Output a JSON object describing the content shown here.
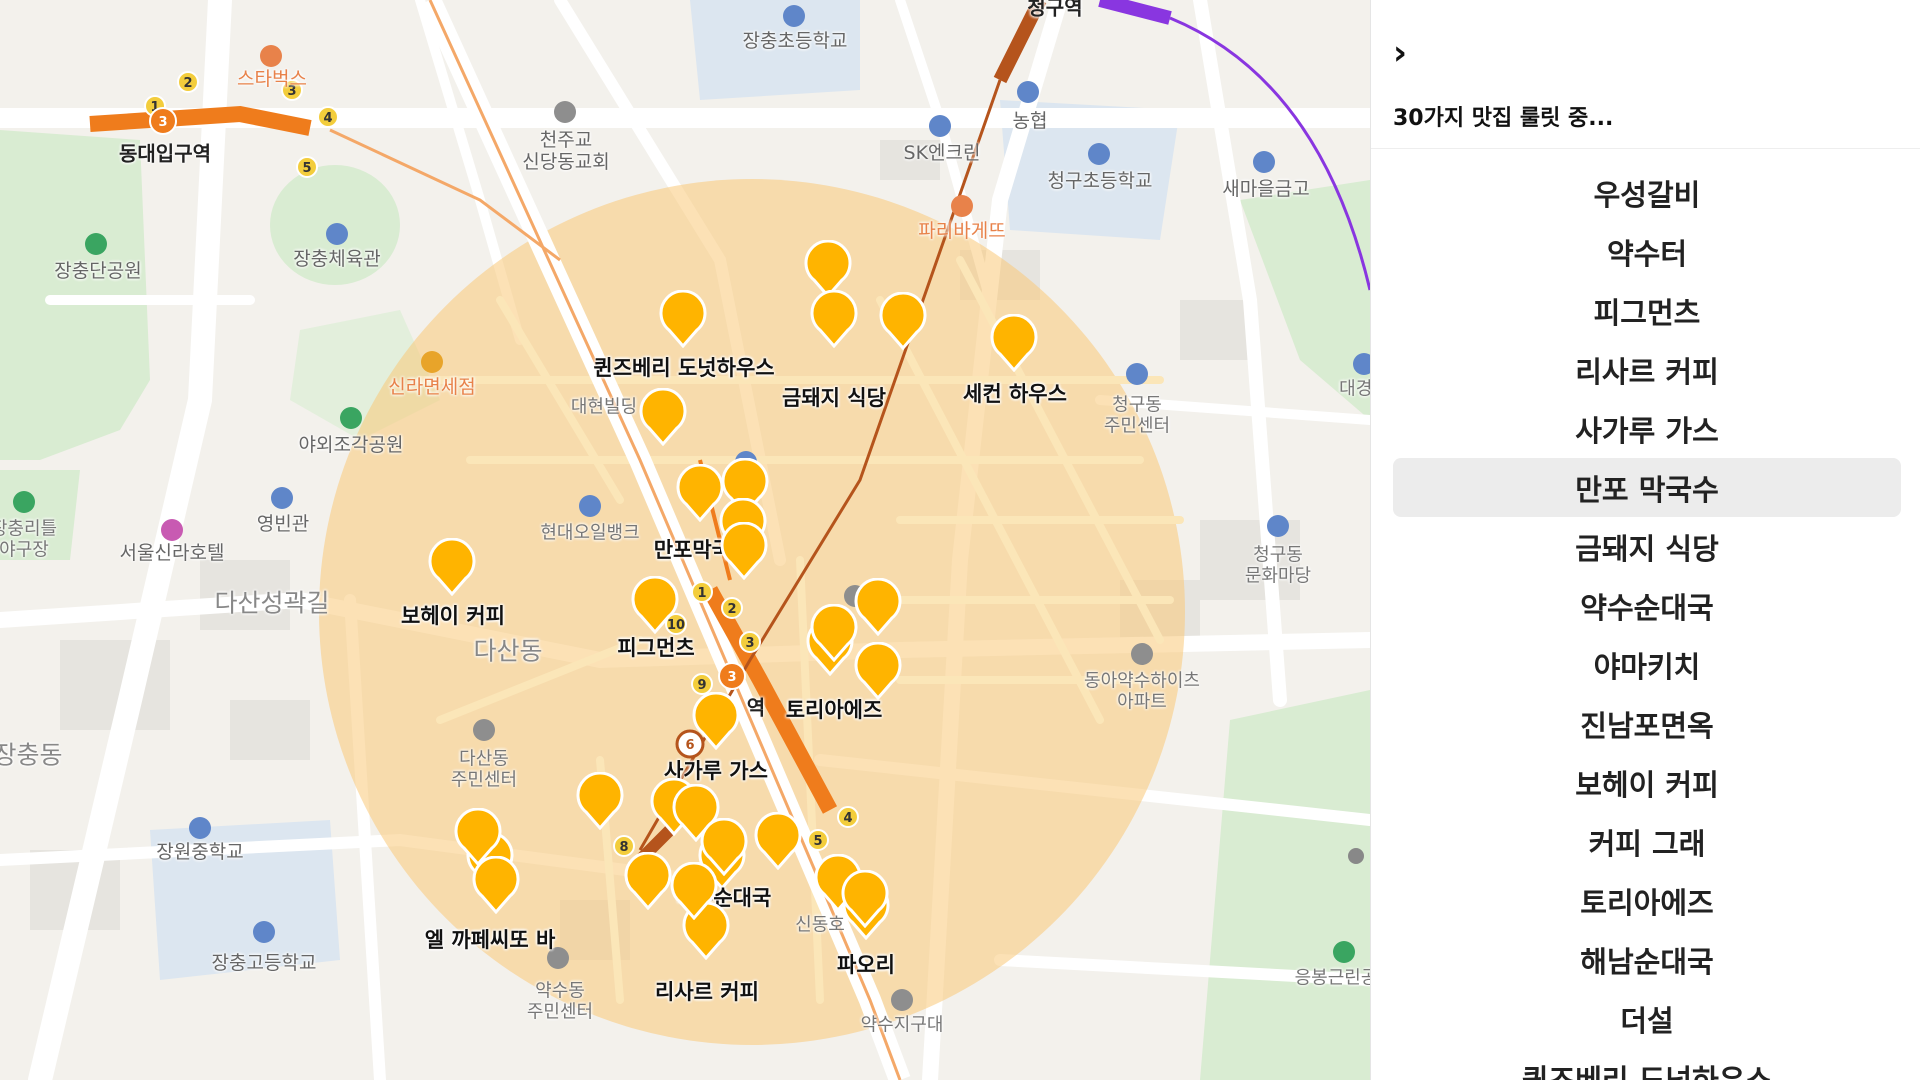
{
  "map": {
    "places": [
      {
        "name": "우성갈비",
        "labeled": false
      },
      {
        "name": "퀸즈베리 도넛하우스",
        "labeled": true
      },
      {
        "name": "금돼지 식당",
        "labeled": true
      },
      {
        "name": "세컨 하우스",
        "labeled": true
      },
      {
        "name": "만포막국수",
        "labeled": true
      },
      {
        "name": "보헤이 커피",
        "labeled": true
      },
      {
        "name": "피그먼츠",
        "labeled": true
      },
      {
        "name": "토리아에즈",
        "labeled": true
      },
      {
        "name": "사가루 가스",
        "labeled": true
      },
      {
        "name": "약수순대국",
        "labeled": true
      },
      {
        "name": "엘 까페씨또 바",
        "labeled": true
      },
      {
        "name": "리사르 커피",
        "labeled": true
      },
      {
        "name": "파오리",
        "labeled": true
      }
    ],
    "labels": {
      "dongdaeipgu": "동대입구역",
      "cheonggu_station": "청구역",
      "starbucks": "스타벅스",
      "jangchung_elem": "장충초등학교",
      "church": "천주교\n신당동교회",
      "nonghyup": "농협",
      "sk": "SK엔크린",
      "paris": "파리바게뜨",
      "cheonggu_elem": "청구초등학교",
      "saemaeul": "새마을금고",
      "jangchung_park": "장충단공원",
      "gym": "장충체육관",
      "shilla_dutyfree": "신라면세점",
      "daehyun": "대현빌딩",
      "sculpture_park": "야외조각공원",
      "yeongbingwan": "영빈관",
      "shilla_hotel": "서울신라호텔",
      "hyundai_oil": "현대오일뱅크",
      "dasan_road": "다산성곽길",
      "dasan_dong": "다산동",
      "dasan_center": "다산동\n주민센터",
      "jangchung_dong": "장충동",
      "jangwon_mid": "장원중학교",
      "jangchung_high": "장충고등학교",
      "yaksu_center": "약수동\n주민센터",
      "yaksu_police": "약수지구대",
      "sindang_dong": "신동호",
      "dongah": "동아약수하이츠\n아파트",
      "cheonggu_center": "청구동\n주민센터",
      "cheonggu_culture": "청구동\n문화마당",
      "daegyeong": "대경중",
      "eungbong": "응봉근린공",
      "yaksu_station": "역",
      "jangchung_stadium": "장충리틀\n야구장"
    }
  },
  "panel": {
    "collapse_icon": "chevron-right-icon",
    "collapse_glyph": "›",
    "status": "30가지 맛집 룰릿 중...",
    "items": [
      "우성갈비",
      "약수터",
      "피그먼츠",
      "리사르 커피",
      "사가루 가스",
      "만포 막국수",
      "금돼지 식당",
      "약수순대국",
      "야마키치",
      "진남포면옥",
      "보헤이 커피",
      "커피 그래",
      "토리아에즈",
      "해남순대국",
      "더설",
      "퀸즈베리 도넛하우스"
    ],
    "selected_index": 5
  },
  "colors": {
    "pin": "#ffb400",
    "circle": "#f9c878",
    "line3": "#ef7c1c",
    "line6": "#b5541c",
    "line5": "#8936e0"
  }
}
